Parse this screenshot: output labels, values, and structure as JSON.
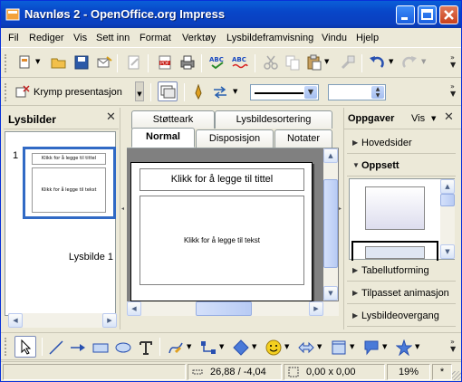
{
  "window": {
    "title": "Navnløs 2 - OpenOffice.org Impress"
  },
  "menu": [
    "Fil",
    "Rediger",
    "Vis",
    "Sett inn",
    "Format",
    "Verktøy",
    "Lysbildeframvisning",
    "Vindu",
    "Hjelp"
  ],
  "toolbar2": {
    "shrink_label": "Krymp presentasjon"
  },
  "slides_panel": {
    "title": "Lysbilder",
    "slide_number": "1",
    "slide_name": "Lysbilde 1",
    "thumb_title": "Klikk for å legge til tittel",
    "thumb_text": "Klikk for å legge til tekst"
  },
  "tabs": {
    "row1": [
      "Støtteark",
      "Lysbildesortering"
    ],
    "row2": [
      "Normal",
      "Disposisjon",
      "Notater"
    ],
    "active": "Normal"
  },
  "slide": {
    "title_placeholder": "Klikk for å legge til tittel",
    "text_placeholder": "Klikk for å legge til tekst"
  },
  "tasks": {
    "title": "Oppgaver",
    "view_label": "Vis",
    "items": [
      "Hovedsider",
      "Oppsett",
      "Tabellutforming",
      "Tilpasset animasjon",
      "Lysbildeovergang"
    ],
    "expanded": "Oppsett"
  },
  "status": {
    "position": "26,88 / -4,04",
    "size": "0,00 x 0,00",
    "zoom": "19%",
    "modified": "*"
  },
  "colors": {
    "titlebar": "#0a4fd0",
    "accent": "#316ac5",
    "panel_bg": "#ece9d8"
  },
  "icons": [
    "app-icon",
    "new-icon",
    "open-icon",
    "save-icon",
    "mail-icon",
    "edit-file-icon",
    "pdf-icon",
    "print-icon",
    "spellcheck-icon",
    "autospell-icon",
    "cut-icon",
    "copy-icon",
    "paste-icon",
    "format-paintbrush-icon",
    "undo-icon",
    "redo-icon",
    "select-arrow-icon",
    "line-icon",
    "arrow-line-icon",
    "rectangle-icon",
    "ellipse-icon",
    "text-icon",
    "curve-icon",
    "connector-icon",
    "basic-shapes-icon",
    "symbol-shapes-icon",
    "block-arrows-icon",
    "flowchart-icon",
    "callouts-icon",
    "stars-icon"
  ]
}
